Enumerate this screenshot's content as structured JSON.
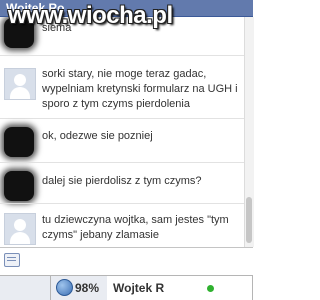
{
  "watermark": "www.wiocha.pl",
  "chat": {
    "title": "Wojtek Ro",
    "messages": [
      {
        "avatar": "hidden",
        "text": "siema"
      },
      {
        "avatar": "default",
        "text": "sorki stary, nie moge teraz gadac, wypelniam kretynski formularz na UGH i sporo z tym czyms pierdolenia"
      },
      {
        "avatar": "hidden",
        "text": "ok, odezwe sie pozniej"
      },
      {
        "avatar": "hidden",
        "text": "dalej sie pierdolisz z tym czyms?"
      },
      {
        "avatar": "default",
        "text": "tu dziewczyna wojtka, sam jestes \"tym czyms\" jebany zlamasie"
      }
    ],
    "input_value": ""
  },
  "taskbar": {
    "percent": "98%",
    "chat_tab_name": "Wojtek R",
    "status": "online",
    "status_color": "#2fb12f"
  },
  "colors": {
    "header": "#627aad",
    "text": "#333333"
  }
}
